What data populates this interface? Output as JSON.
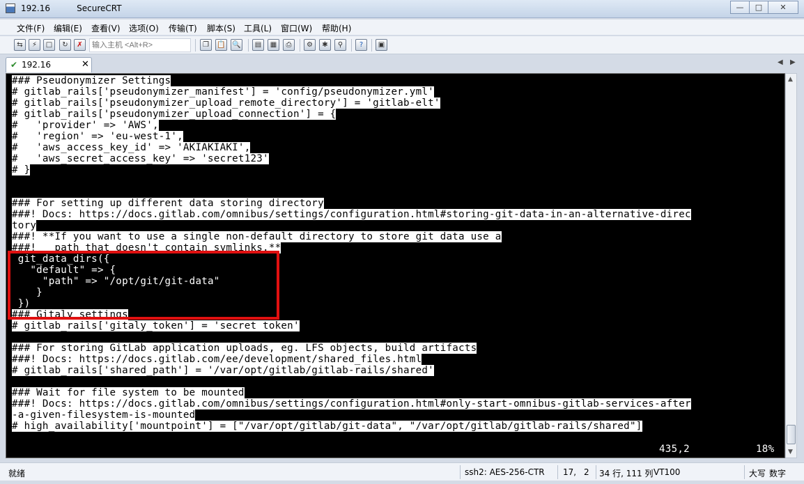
{
  "window": {
    "title_ip": "192.16",
    "title_app": "SecureCRT"
  },
  "menu": [
    "文件(F)",
    "编辑(E)",
    "查看(V)",
    "选项(O)",
    "传输(T)",
    "脚本(S)",
    "工具(L)",
    "窗口(W)",
    "帮助(H)"
  ],
  "toolbar": {
    "host_input_placeholder": "输入主机 <Alt+R>"
  },
  "tab": {
    "label": "192.16"
  },
  "terminal": {
    "lines": [
      {
        "text": "### Pseudonymizer Settings",
        "hl": true
      },
      {
        "text": "# gitlab_rails['pseudonymizer_manifest'] = 'config/pseudonymizer.yml'",
        "hl": true
      },
      {
        "text": "# gitlab_rails['pseudonymizer_upload_remote_directory'] = 'gitlab-elt'",
        "hl": true
      },
      {
        "text": "# gitlab_rails['pseudonymizer_upload_connection'] = {",
        "hl": true
      },
      {
        "text": "#   'provider' => 'AWS',",
        "hl": true
      },
      {
        "text": "#   'region' => 'eu-west-1',",
        "hl": true
      },
      {
        "text": "#   'aws_access_key_id' => 'AKIAKIAKI',",
        "hl": true
      },
      {
        "text": "#   'aws_secret_access_key' => 'secret123'",
        "hl": true
      },
      {
        "text": "# }",
        "hl": true
      },
      {
        "text": "",
        "hl": false
      },
      {
        "text": "",
        "hl": false
      },
      {
        "text": "### For setting up different data storing directory",
        "hl": true
      },
      {
        "text": "###! Docs: https://docs.gitlab.com/omnibus/settings/configuration.html#storing-git-data-in-an-alternative-direc",
        "hl": true
      },
      {
        "text": "tory",
        "hl": true
      },
      {
        "text": "###! **If you want to use a single non-default directory to store git data use a",
        "hl": true
      },
      {
        "text": "###!   path that doesn't contain symlinks.**",
        "hl": true
      },
      {
        "text": " git_data_dirs({",
        "hl": false
      },
      {
        "text": "   \"default\" => {",
        "hl": false
      },
      {
        "text": "     \"path\" => \"/opt/git/git-data\"",
        "hl": false
      },
      {
        "text": "    }",
        "hl": false
      },
      {
        "text": " })",
        "hl": false
      },
      {
        "text": "### Gitaly settings",
        "hl": true
      },
      {
        "text": "# gitlab_rails['gitaly_token'] = 'secret token'",
        "hl": true
      },
      {
        "text": "",
        "hl": false
      },
      {
        "text": "### For storing GitLab application uploads, eg. LFS objects, build artifacts",
        "hl": true
      },
      {
        "text": "###! Docs: https://docs.gitlab.com/ee/development/shared_files.html",
        "hl": true
      },
      {
        "text": "# gitlab_rails['shared_path'] = '/var/opt/gitlab/gitlab-rails/shared'",
        "hl": true
      },
      {
        "text": "",
        "hl": false
      },
      {
        "text": "### Wait for file system to be mounted",
        "hl": true
      },
      {
        "text": "###! Docs: https://docs.gitlab.com/omnibus/settings/configuration.html#only-start-omnibus-gitlab-services-after",
        "hl": true
      },
      {
        "text": "-a-given-filesystem-is-mounted",
        "hl": true
      },
      {
        "text": "# high_availability['mountpoint'] = [\"/var/opt/gitlab/git-data\", \"/var/opt/gitlab/gitlab-rails/shared\"]",
        "hl": true
      }
    ],
    "cursor_pos": "435,2",
    "percent": "18%"
  },
  "statusbar": {
    "ready": "就绪",
    "protocol": "ssh2: AES-256-CTR",
    "row": "17,",
    "col": "2",
    "size": "34 行, 111 列",
    "term": "VT100",
    "caps": "大写",
    "num": "数字"
  }
}
